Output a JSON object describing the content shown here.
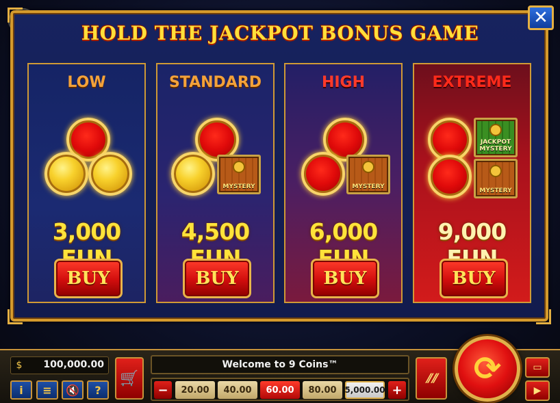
{
  "modal": {
    "title": "HOLD THE JACKPOT BONUS GAME",
    "close_label": "✕"
  },
  "exit_label": "⇥",
  "tiers": [
    {
      "name": "LOW",
      "price": "3,000 FUN",
      "buy": "BUY"
    },
    {
      "name": "STANDARD",
      "price": "4,500 FUN",
      "buy": "BUY",
      "mystery": "MYSTERY"
    },
    {
      "name": "HIGH",
      "price": "6,000 FUN",
      "buy": "BUY",
      "mystery": "MYSTERY"
    },
    {
      "name": "EXTREME",
      "price": "9,000 FUN",
      "buy": "BUY",
      "jackpot_mystery": "JACKPOT MYSTERY",
      "mystery": "MYSTERY"
    }
  ],
  "bottom_bar": {
    "balance": "100,000.00",
    "welcome": "Welcome to 9 Coins™",
    "bet_options": [
      "20.00",
      "40.00",
      "60.00",
      "80.00",
      "5,000.00"
    ],
    "selected_bet": "60.00",
    "minus": "−",
    "plus": "+",
    "info_icon": "i",
    "menu_icon": "≡",
    "sound_icon": "🔇",
    "help_icon": "?",
    "autoplay_label": "⫽⫽"
  },
  "colors": {
    "gold": "#ffdf3a",
    "border": "#d59a2c",
    "button_red": "#d00d0d"
  }
}
